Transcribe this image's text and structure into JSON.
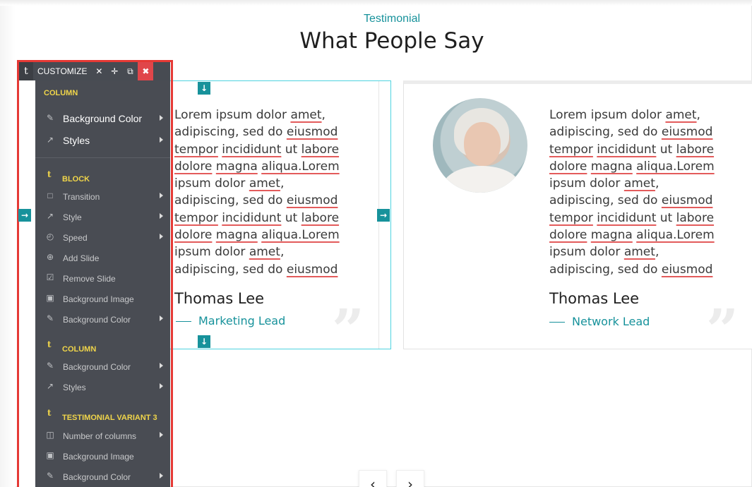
{
  "section": {
    "eyebrow": "Testimonial",
    "heading": "What People Say"
  },
  "testimonials": [
    {
      "quote_parts": [
        "Lorem ipsum dolor ",
        "amet",
        ", adipiscing, sed do ",
        "eiusmod",
        " ",
        "tempor",
        " ",
        "incididunt",
        " ut ",
        "labore",
        " ",
        "dolore",
        " ",
        "magna",
        " ",
        "aliqua.Lorem",
        " ipsum dolor ",
        "amet",
        ", adipiscing, sed do ",
        "eiusmod",
        " ",
        "tempor",
        " ",
        "incididunt",
        " ut ",
        "labore",
        " ",
        "dolore",
        " ",
        "magna",
        " ",
        "aliqua.Lorem",
        " ipsum dolor ",
        "amet",
        ", adipiscing, sed do ",
        "eiusmod"
      ],
      "name": "Thomas Lee",
      "role": "Marketing Lead",
      "quote_mark": "”"
    },
    {
      "quote_parts": [
        "Lorem ipsum dolor ",
        "amet",
        ", adipiscing, sed do ",
        "eiusmod",
        " ",
        "tempor",
        " ",
        "incididunt",
        " ut ",
        "labore",
        " ",
        "dolore",
        " ",
        "magna",
        " ",
        "aliqua.Lorem",
        " ipsum dolor ",
        "amet",
        ", adipiscing, sed do ",
        "eiusmod",
        " ",
        "tempor",
        " ",
        "incididunt",
        " ut ",
        "labore",
        " ",
        "dolore",
        " ",
        "magna",
        " ",
        "aliqua.Lorem",
        " ipsum dolor ",
        "amet",
        ", adipiscing, sed do ",
        "eiusmod"
      ],
      "name": "Thomas Lee",
      "role": "Network Lead",
      "quote_mark": "”"
    }
  ],
  "carousel": {
    "prev": "‹",
    "next": "›"
  },
  "toolbar": {
    "t_glyph": "t",
    "label": "CUSTOMIZE",
    "close": "✕",
    "move": "✛",
    "copy": "⧉",
    "delete": "✖"
  },
  "menu": {
    "column_header": "COLUMN",
    "column_items": [
      {
        "icon": "✎",
        "label": "Background Color"
      },
      {
        "icon": "↗",
        "label": "Styles"
      }
    ],
    "block_header": "BLOCK",
    "block_items": [
      {
        "icon": "□",
        "label": "Transition",
        "submenu": true
      },
      {
        "icon": "↗",
        "label": "Style",
        "submenu": true
      },
      {
        "icon": "◴",
        "label": "Speed",
        "submenu": true
      },
      {
        "icon": "⊕",
        "label": "Add Slide",
        "submenu": false
      },
      {
        "icon": "☑",
        "label": "Remove Slide",
        "submenu": false
      },
      {
        "icon": "▣",
        "label": "Background Image",
        "submenu": false
      },
      {
        "icon": "✎",
        "label": "Background Color",
        "submenu": true
      }
    ],
    "column2_header": "COLUMN",
    "column2_items": [
      {
        "icon": "✎",
        "label": "Background Color"
      },
      {
        "icon": "↗",
        "label": "Styles"
      }
    ],
    "variant_header": "TESTIMONIAL VARIANT 3",
    "variant_items": [
      {
        "icon": "◫",
        "label": "Number of columns",
        "submenu": true
      },
      {
        "icon": "▣",
        "label": "Background Image",
        "submenu": false
      },
      {
        "icon": "✎",
        "label": "Background Color",
        "submenu": true
      }
    ]
  },
  "colors": {
    "accent": "#17929b",
    "panel_bg": "#494c53",
    "panel_header": "#f0d54a",
    "outline": "#e53935",
    "spell_underline": "#e35b5b"
  }
}
